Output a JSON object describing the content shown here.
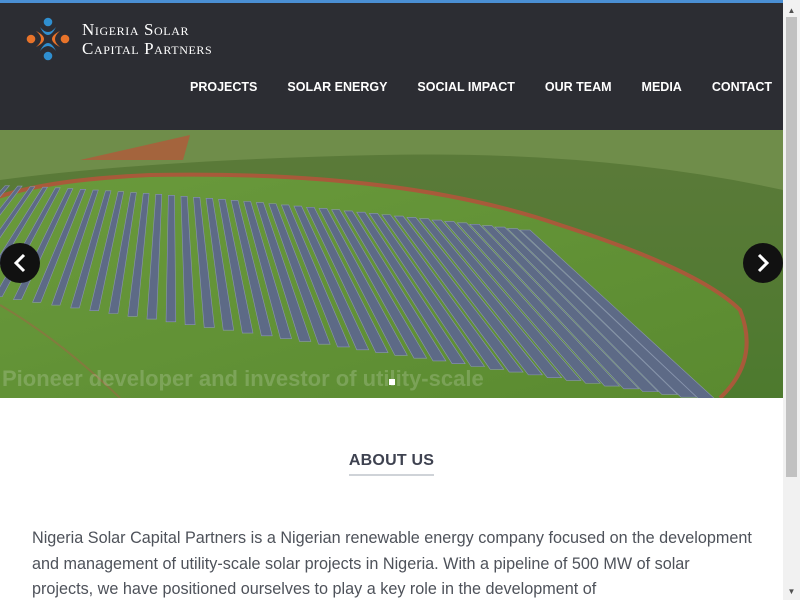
{
  "brand": {
    "line1": "Nigeria Solar",
    "line2": "Capital Partners"
  },
  "nav": {
    "items": [
      {
        "label": "PROJECTS"
      },
      {
        "label": "SOLAR ENERGY"
      },
      {
        "label": "SOCIAL IMPACT"
      },
      {
        "label": "OUR TEAM"
      },
      {
        "label": "MEDIA"
      },
      {
        "label": "CONTACT"
      }
    ]
  },
  "hero": {
    "caption": "Pioneer developer and investor of utility-scale",
    "icons": {
      "prev": "chevron-left-icon",
      "next": "chevron-right-icon"
    }
  },
  "about": {
    "title": "ABOUT US",
    "body": "Nigeria Solar Capital Partners is a Nigerian renewable energy company focused on the development and management of utility-scale solar projects in Nigeria. With a pipeline of 500 MW of solar projects, we have positioned ourselves to play a key role in the development of"
  },
  "colors": {
    "header_bg": "#2c2d33",
    "accent": "#4a8fd4",
    "logo_blue": "#2f8fd0",
    "logo_orange": "#e8732a"
  }
}
